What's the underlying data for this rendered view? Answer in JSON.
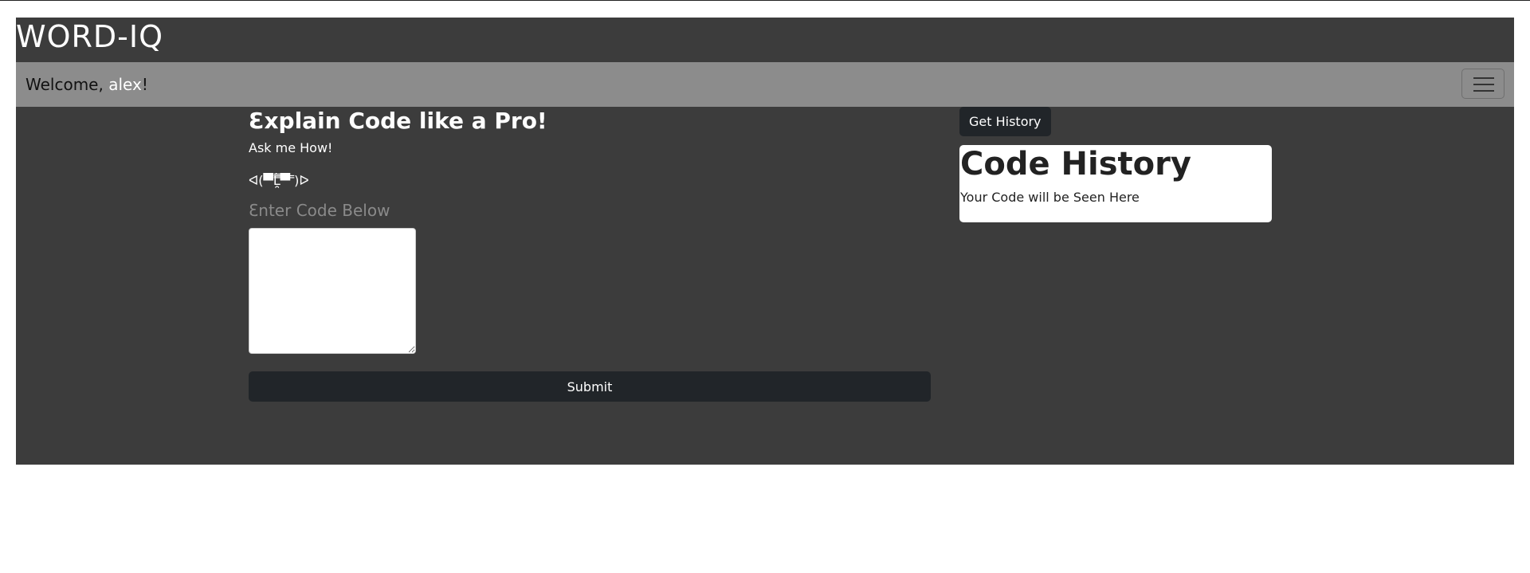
{
  "brand": {
    "title": "WORD-IQ"
  },
  "nav": {
    "welcome_prefix": "Welcome, ",
    "username": "alex",
    "welcome_suffix": "!",
    "menu_icon": "hamburger-icon"
  },
  "main": {
    "heading": "Ɛxplain Code like a Pro!",
    "subheading": "Ask me How!",
    "kaomoji": "ᐊ(▀̿̿Ĺ̯̿̿▀̿ ̿)ᐅ",
    "code_label": "Ɛnter Code Below",
    "code_value": "",
    "submit_label": "Submit"
  },
  "history": {
    "button_label": "Get History",
    "card_title": "Code History",
    "card_text": "Your Code will be Seen Here"
  },
  "colors": {
    "background": "#3c3c3c",
    "nav": "#8c8c8c",
    "button": "#212529"
  }
}
